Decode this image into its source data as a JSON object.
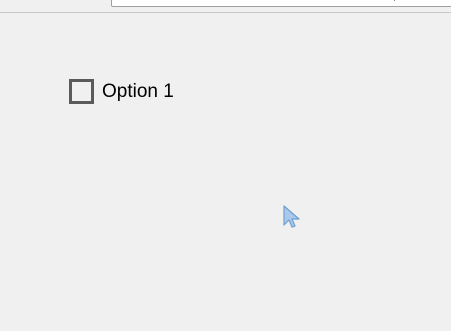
{
  "options": [
    {
      "label": "Option 1",
      "checked": false
    }
  ],
  "icons": {
    "cursor": "mouse-pointer-icon"
  },
  "colors": {
    "background": "#f0f0f0",
    "checkbox_border": "#5a5a5a",
    "cursor_fill": "#a9c9ec"
  }
}
